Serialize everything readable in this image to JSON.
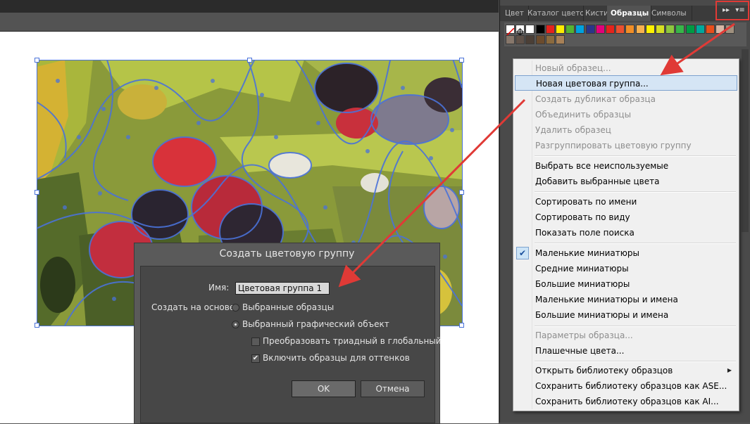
{
  "panel": {
    "tabs": [
      "Цвет",
      "Каталог цветов",
      "Кисти",
      "Образцы",
      "Символы"
    ],
    "active_tab": "Образцы",
    "swatches": [
      "#ffffff",
      "#000000",
      "#e5231d",
      "#ffec00",
      "#56b331",
      "#00a2de",
      "#2b3589",
      "#e2007a",
      "#e5231d",
      "#ea5030",
      "#f18e27",
      "#f7b14f",
      "#fff100",
      "#d6df23",
      "#8dc63f",
      "#38b54a",
      "#009a44",
      "#00a99d",
      "#e84e1b",
      "#d6b8a6",
      "#a0917f",
      "#87776b",
      "#5f5148",
      "#4b3f36",
      "#6b4b2d",
      "#8a6a3e",
      "#a88157"
    ]
  },
  "menu": {
    "items": [
      {
        "label": "Новый образец...",
        "enabled": false
      },
      {
        "label": "Новая цветовая группа...",
        "enabled": true,
        "highlighted": true
      },
      {
        "label": "Создать дубликат образца",
        "enabled": false
      },
      {
        "label": "Объединить образцы",
        "enabled": false
      },
      {
        "label": "Удалить образец",
        "enabled": false
      },
      {
        "label": "Разгруппировать цветовую группу",
        "enabled": false
      },
      {
        "label": "Выбрать все неиспользуемые",
        "enabled": true
      },
      {
        "label": "Добавить выбранные цвета",
        "enabled": true
      },
      {
        "label": "Сортировать по имени",
        "enabled": true
      },
      {
        "label": "Сортировать по виду",
        "enabled": true
      },
      {
        "label": "Показать поле поиска",
        "enabled": true
      },
      {
        "label": "Маленькие миниатюры",
        "enabled": true,
        "checked": true
      },
      {
        "label": "Средние миниатюры",
        "enabled": true
      },
      {
        "label": "Большие миниатюры",
        "enabled": true
      },
      {
        "label": "Маленькие миниатюры и имена",
        "enabled": true
      },
      {
        "label": "Большие миниатюры и имена",
        "enabled": true
      },
      {
        "label": "Параметры образца...",
        "enabled": false
      },
      {
        "label": "Плашечные цвета...",
        "enabled": true
      },
      {
        "label": "Открыть библиотеку образцов",
        "enabled": true,
        "submenu": true
      },
      {
        "label": "Сохранить библиотеку образцов как ASE...",
        "enabled": true
      },
      {
        "label": "Сохранить библиотеку образцов как AI...",
        "enabled": true
      }
    ]
  },
  "dialog": {
    "title": "Создать цветовую группу",
    "name_label": "Имя:",
    "name_value": "Цветовая группа 1",
    "based_on_label": "Создать на основе",
    "radio_swatches": "Выбранные образцы",
    "radio_artwork": "Выбранный графический объект",
    "selected_radio": "artwork",
    "checkbox_triad": "Преобразовать триадный в глобальный",
    "checkbox_triad_checked": false,
    "checkbox_tints": "Включить образцы для оттенков",
    "checkbox_tints_checked": true,
    "ok_label": "OK",
    "cancel_label": "Отмена"
  },
  "annotation_color": "#e03a36",
  "selection_color": "#4a72d9"
}
